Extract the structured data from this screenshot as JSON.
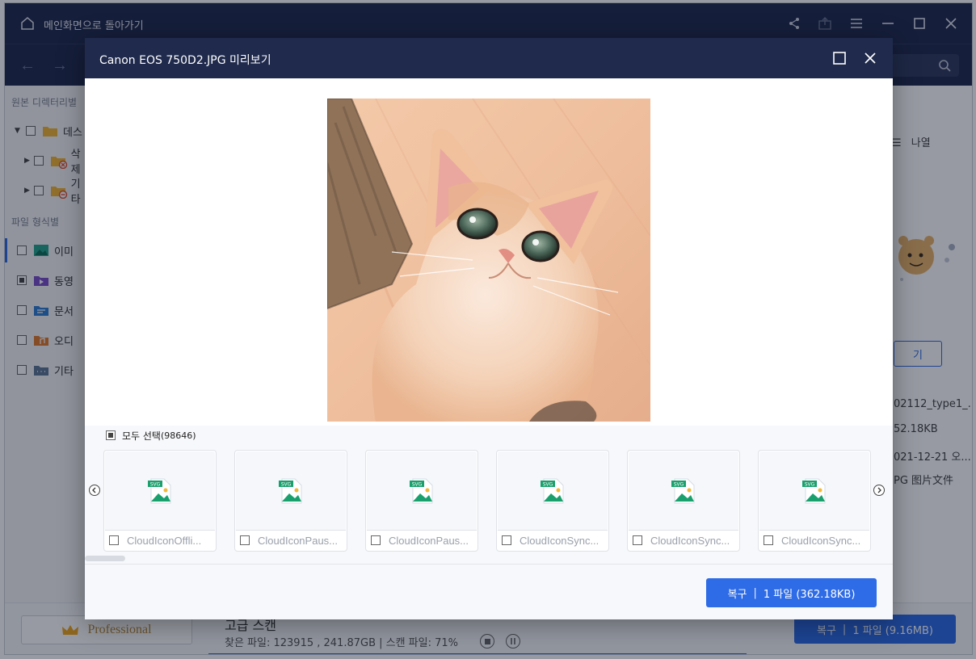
{
  "app": {
    "title": "메인화면으로 돌아가기",
    "search_placeholder": "",
    "sidebar": {
      "source_heading": "원본 디렉터리별",
      "tree": [
        {
          "label": "데스",
          "icon": "folder-icon"
        },
        {
          "label": "삭제",
          "icon": "deleted-folder-icon"
        },
        {
          "label": "기타",
          "icon": "other-folder-icon"
        }
      ],
      "type_heading": "파일 형식별",
      "types": [
        {
          "label": "이미",
          "icon": "image-type-icon"
        },
        {
          "label": "동영",
          "icon": "video-type-icon"
        },
        {
          "label": "문서",
          "icon": "document-type-icon"
        },
        {
          "label": "오디",
          "icon": "audio-type-icon"
        },
        {
          "label": "기타",
          "icon": "other-type-icon"
        }
      ]
    },
    "right_panel": {
      "sort_label": "나열",
      "preview_button": "기",
      "file_name": "02112_type1_...",
      "file_size": "52.18KB",
      "file_date": "021-12-21 오...",
      "file_type": "PG 图片文件"
    },
    "bottom": {
      "pro_label": "Professional",
      "scan_title": "고급 스캔",
      "scan_status": "찾은 파일: 123915 , 241.87GB | 스캔 파일: 71%",
      "progress": 0.71,
      "recover_label": "복구",
      "recover_detail": "1 파일 (9.16MB)"
    }
  },
  "modal": {
    "title": "Canon EOS 750D2.JPG 미리보기",
    "select_all_label": "모두 선택",
    "select_all_count": "(98646)",
    "thumbnails": [
      {
        "name": "CloudIconOffli..."
      },
      {
        "name": "CloudIconPaus..."
      },
      {
        "name": "CloudIconPaus..."
      },
      {
        "name": "CloudIconSync..."
      },
      {
        "name": "CloudIconSync..."
      },
      {
        "name": "CloudIconSync..."
      }
    ],
    "recover_label": "복구",
    "recover_detail": "1 파일 (362.18KB)"
  },
  "colors": {
    "accent": "#2e6be6",
    "header": "#1f2a4d",
    "svg_icon_green": "#1aa06d"
  }
}
